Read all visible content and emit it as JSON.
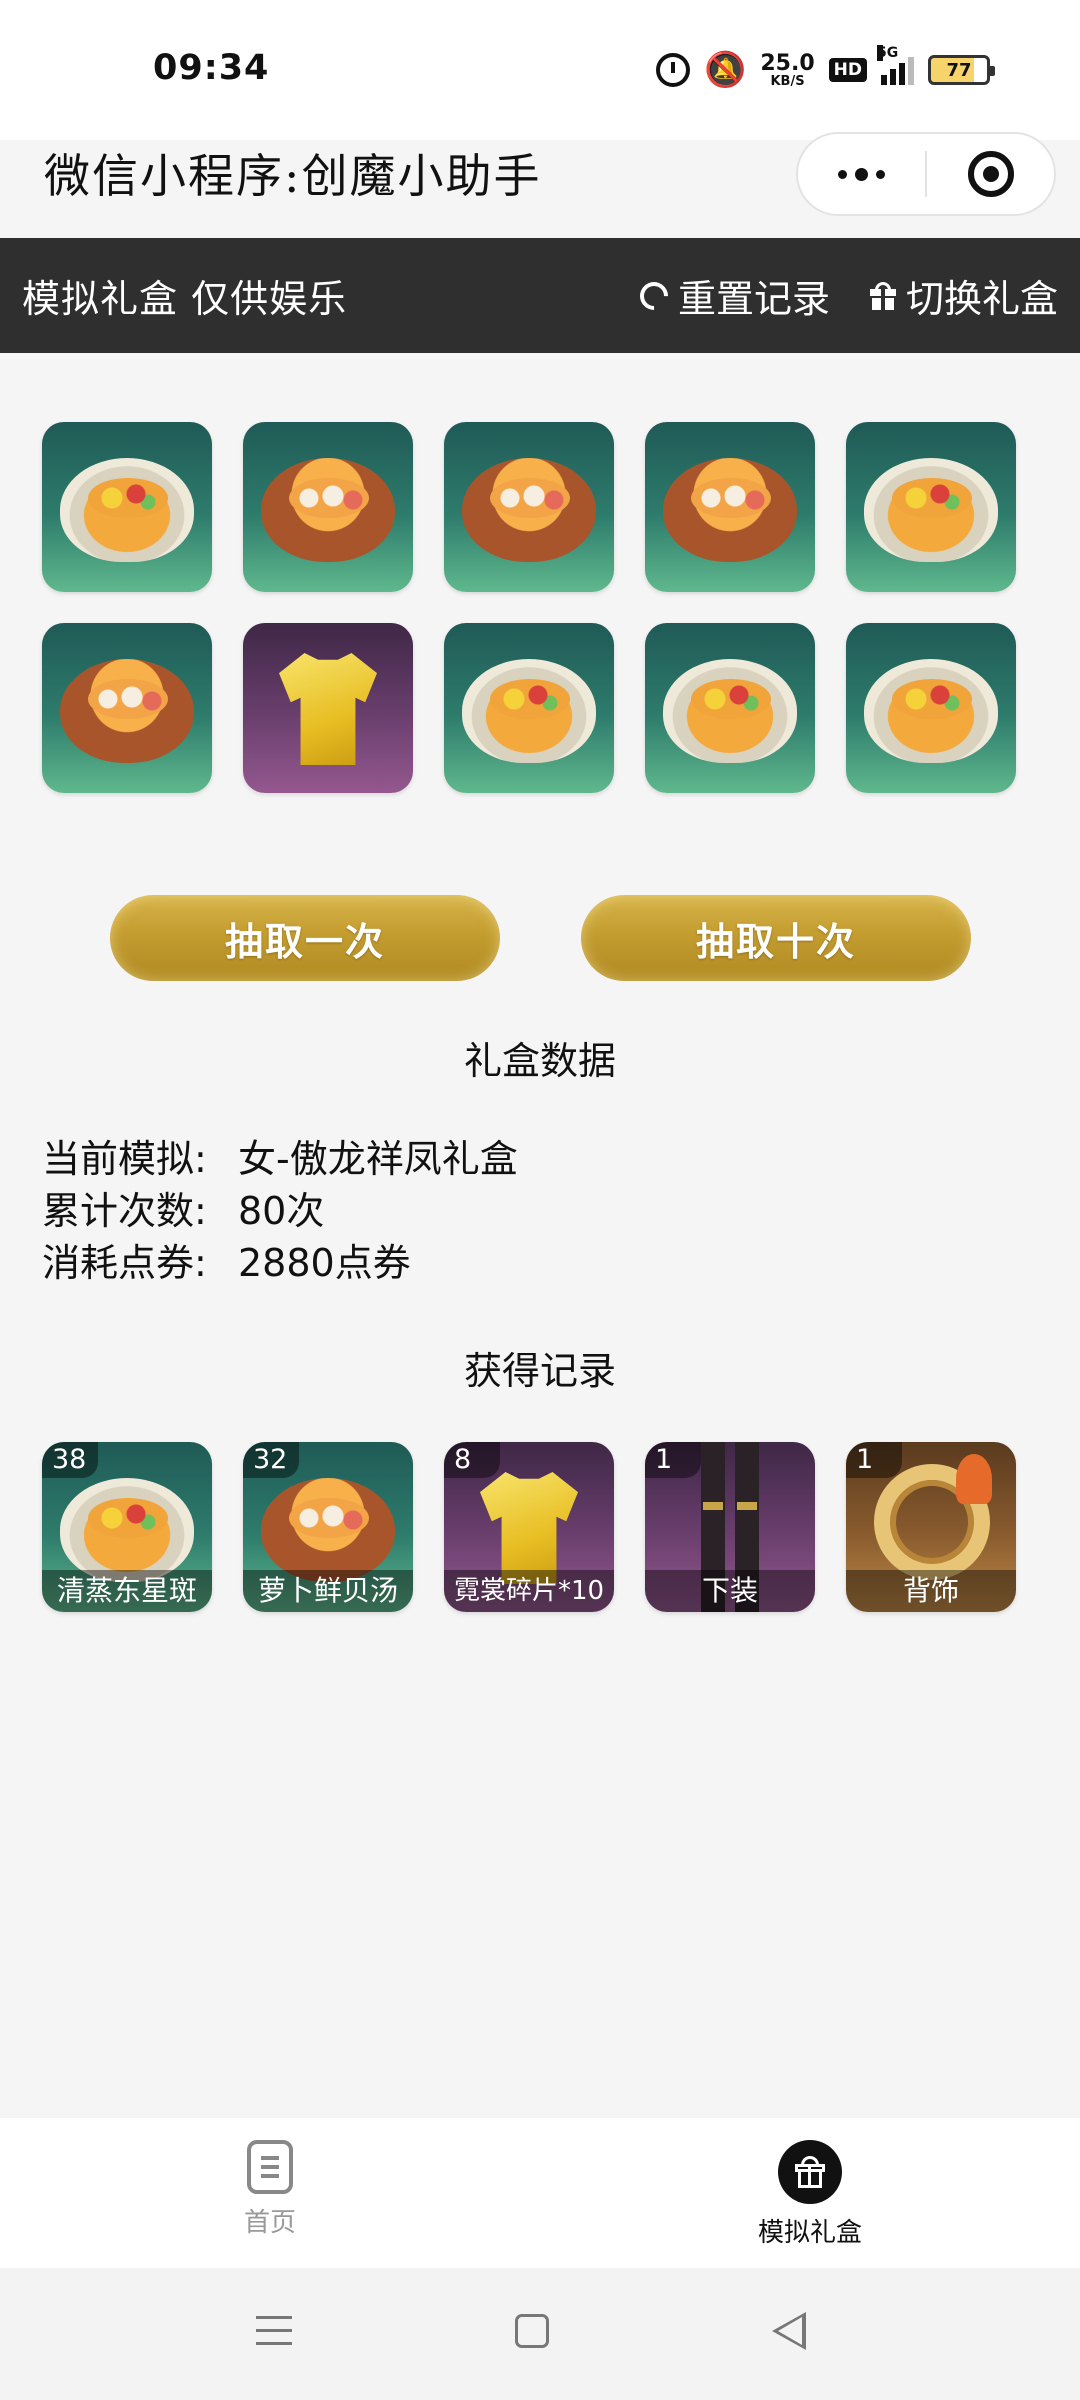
{
  "status_bar": {
    "time": "09:34",
    "net_speed_value": "25.0",
    "net_speed_unit": "KB/S",
    "hd_label": "HD",
    "signal_label": "5G",
    "battery_level": "77"
  },
  "miniprogram": {
    "title": "微信小程序:创魔小助手"
  },
  "header": {
    "title": "模拟礼盒 仅供娱乐",
    "reset_label": "重置记录",
    "switch_label": "切换礼盒"
  },
  "draw_results": [
    {
      "icon": "steamed-fish-icon",
      "bg": "#2e7c6c"
    },
    {
      "icon": "scallop-soup-icon",
      "bg": "#2e7c6c"
    },
    {
      "icon": "scallop-soup-icon",
      "bg": "#2e7c6c"
    },
    {
      "icon": "scallop-soup-icon",
      "bg": "#2e7c6c"
    },
    {
      "icon": "steamed-fish-icon",
      "bg": "#2e7c6c"
    },
    {
      "icon": "scallop-soup-icon",
      "bg": "#2e7c6c"
    },
    {
      "icon": "shirt-icon",
      "bg": "#6a3f6e"
    },
    {
      "icon": "steamed-fish-icon",
      "bg": "#2e7c6c"
    },
    {
      "icon": "steamed-fish-icon",
      "bg": "#2e7c6c"
    },
    {
      "icon": "steamed-fish-icon",
      "bg": "#2e7c6c"
    }
  ],
  "buttons": {
    "draw_once": "抽取一次",
    "draw_ten": "抽取十次"
  },
  "stats_section": {
    "title": "礼盒数据",
    "rows": [
      {
        "label": "当前模拟:",
        "value": "女-傲龙祥凤礼盒"
      },
      {
        "label": "累计次数:",
        "value": "80次"
      },
      {
        "label": "消耗点券:",
        "value": "2880点券"
      }
    ]
  },
  "records_section": {
    "title": "获得记录",
    "items": [
      {
        "count": "38",
        "name": "清蒸东星斑",
        "icon": "steamed-fish-icon"
      },
      {
        "count": "32",
        "name": "萝卜鲜贝汤",
        "icon": "scallop-soup-icon"
      },
      {
        "count": "8",
        "name": "霓裳碎片*10",
        "icon": "shirt-icon"
      },
      {
        "count": "1",
        "name": "下装",
        "icon": "pants-icon"
      },
      {
        "count": "1",
        "name": "背饰",
        "icon": "back-accessory-icon"
      }
    ]
  },
  "tab_bar": {
    "home_label": "首页",
    "gift_label": "模拟礼盒",
    "active_tab": "模拟礼盒"
  },
  "colors": {
    "header_bg": "#2f2f2f",
    "gold_button": "#c49d30",
    "green_tile": "#2e7c6c",
    "purple_tile": "#6a3f6e",
    "orange_tile": "#8a5c2e"
  }
}
